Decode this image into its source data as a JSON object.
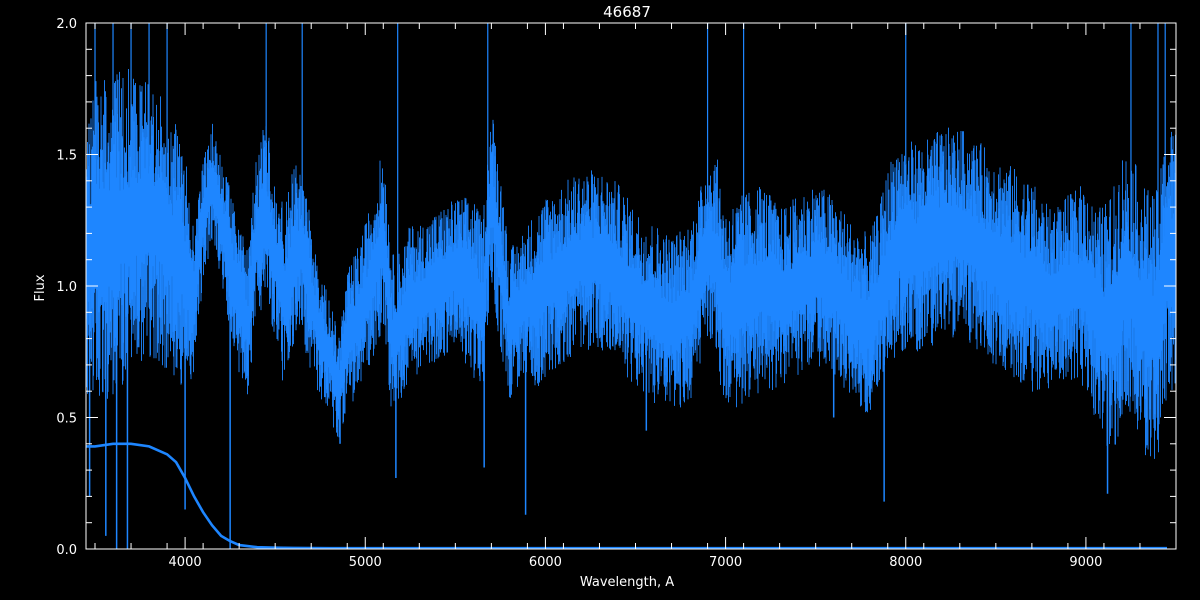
{
  "chart_data": {
    "type": "line",
    "title": "46687",
    "xlabel": "Wavelength, A",
    "ylabel": "Flux",
    "xlim": [
      3450,
      9500
    ],
    "ylim": [
      0.0,
      2.0
    ],
    "grid": false,
    "background_color": "#000000",
    "axis_color": "#ffffff",
    "line_color": "#1e86ff",
    "x_ticks": [
      {
        "value": 4000,
        "label": "4000"
      },
      {
        "value": 5000,
        "label": "5000"
      },
      {
        "value": 6000,
        "label": "6000"
      },
      {
        "value": 7000,
        "label": "7000"
      },
      {
        "value": 8000,
        "label": "8000"
      },
      {
        "value": 9000,
        "label": "9000"
      }
    ],
    "y_ticks": [
      {
        "value": 0.0,
        "label": "0.0"
      },
      {
        "value": 0.5,
        "label": "0.5"
      },
      {
        "value": 1.0,
        "label": "1.0"
      },
      {
        "value": 1.5,
        "label": "1.5"
      },
      {
        "value": 2.0,
        "label": "2.0"
      }
    ],
    "series": [
      {
        "style": "noisy-spectrum",
        "x": [
          3450,
          3500,
          3600,
          3700,
          3800,
          3900,
          4000,
          4050,
          4100,
          4150,
          4200,
          4250,
          4300,
          4350,
          4400,
          4450,
          4500,
          4550,
          4600,
          4650,
          4700,
          4750,
          4800,
          4850,
          4900,
          4950,
          5000,
          5050,
          5100,
          5150,
          5200,
          5250,
          5300,
          5400,
          5500,
          5600,
          5650,
          5700,
          5750,
          5800,
          5850,
          5900,
          5950,
          6000,
          6100,
          6200,
          6300,
          6400,
          6500,
          6600,
          6700,
          6800,
          6850,
          6900,
          6950,
          7000,
          7100,
          7200,
          7300,
          7400,
          7500,
          7600,
          7700,
          7800,
          7850,
          7900,
          7950,
          8000,
          8100,
          8200,
          8300,
          8400,
          8500,
          8600,
          8700,
          8800,
          8900,
          9000,
          9050,
          9100,
          9150,
          9200,
          9250,
          9300,
          9350,
          9400,
          9450
        ],
        "center": [
          1.15,
          1.15,
          1.2,
          1.25,
          1.25,
          1.2,
          1.05,
          0.95,
          1.25,
          1.4,
          1.25,
          1.1,
          0.95,
          0.85,
          1.2,
          1.3,
          1.1,
          0.95,
          1.1,
          1.15,
          0.95,
          0.8,
          0.75,
          0.6,
          0.8,
          0.85,
          0.95,
          1.05,
          1.2,
          0.8,
          0.85,
          0.95,
          0.95,
          1.0,
          1.05,
          1.0,
          0.9,
          1.35,
          1.1,
          0.85,
          0.9,
          0.95,
          0.95,
          1.0,
          1.05,
          1.1,
          1.1,
          1.05,
          0.95,
          0.9,
          0.85,
          0.9,
          1.0,
          1.15,
          1.1,
          0.9,
          0.95,
          1.0,
          0.95,
          1.0,
          1.05,
          1.0,
          0.9,
          0.85,
          0.95,
          1.05,
          1.15,
          1.15,
          1.15,
          1.2,
          1.2,
          1.15,
          1.1,
          1.05,
          1.0,
          0.95,
          1.0,
          1.0,
          0.9,
          0.85,
          0.85,
          1.0,
          1.0,
          0.9,
          0.85,
          0.85,
          1.1
        ],
        "spread": [
          0.5,
          0.55,
          0.55,
          0.5,
          0.45,
          0.45,
          0.4,
          0.25,
          0.2,
          0.2,
          0.2,
          0.25,
          0.25,
          0.25,
          0.3,
          0.3,
          0.3,
          0.3,
          0.3,
          0.3,
          0.25,
          0.2,
          0.2,
          0.18,
          0.22,
          0.25,
          0.25,
          0.28,
          0.3,
          0.28,
          0.25,
          0.25,
          0.25,
          0.25,
          0.25,
          0.3,
          0.3,
          0.3,
          0.3,
          0.25,
          0.25,
          0.25,
          0.3,
          0.3,
          0.3,
          0.3,
          0.3,
          0.3,
          0.3,
          0.3,
          0.3,
          0.3,
          0.3,
          0.3,
          0.35,
          0.35,
          0.35,
          0.35,
          0.3,
          0.3,
          0.3,
          0.3,
          0.3,
          0.3,
          0.3,
          0.35,
          0.35,
          0.35,
          0.35,
          0.35,
          0.35,
          0.35,
          0.35,
          0.35,
          0.35,
          0.3,
          0.3,
          0.35,
          0.35,
          0.4,
          0.45,
          0.45,
          0.45,
          0.45,
          0.45,
          0.45,
          0.45
        ]
      },
      {
        "style": "smooth-curve",
        "x": [
          3450,
          3500,
          3600,
          3700,
          3800,
          3900,
          3950,
          4000,
          4050,
          4100,
          4150,
          4200,
          4250,
          4300,
          4400,
          4500,
          4600,
          4800,
          5000,
          6000,
          7000,
          8000,
          9000,
          9450
        ],
        "y": [
          0.39,
          0.39,
          0.4,
          0.4,
          0.39,
          0.36,
          0.33,
          0.27,
          0.2,
          0.14,
          0.09,
          0.05,
          0.03,
          0.015,
          0.007,
          0.005,
          0.004,
          0.003,
          0.003,
          0.003,
          0.003,
          0.003,
          0.003,
          0.003
        ]
      }
    ],
    "absorption_lines": [
      {
        "x": 3470,
        "y_low": 0.2
      },
      {
        "x": 3560,
        "y_low": 0.05
      },
      {
        "x": 3620,
        "y_low": 0.0
      },
      {
        "x": 3680,
        "y_low": 0.0
      },
      {
        "x": 4000,
        "y_low": 0.15
      },
      {
        "x": 4250,
        "y_low": 0.0
      },
      {
        "x": 4860,
        "y_low": 0.4
      },
      {
        "x": 5170,
        "y_low": 0.27
      },
      {
        "x": 5660,
        "y_low": 0.31
      },
      {
        "x": 5890,
        "y_low": 0.13
      },
      {
        "x": 6560,
        "y_low": 0.45
      },
      {
        "x": 7600,
        "y_low": 0.5
      },
      {
        "x": 7880,
        "y_low": 0.18
      },
      {
        "x": 9120,
        "y_low": 0.21
      }
    ],
    "spikes": [
      {
        "x": 3500,
        "y_high": 2.0
      },
      {
        "x": 3600,
        "y_high": 2.0
      },
      {
        "x": 3700,
        "y_high": 2.0
      },
      {
        "x": 3800,
        "y_high": 2.0
      },
      {
        "x": 3900,
        "y_high": 2.0
      },
      {
        "x": 4450,
        "y_high": 2.0
      },
      {
        "x": 4650,
        "y_high": 2.0
      },
      {
        "x": 5180,
        "y_high": 2.0
      },
      {
        "x": 5680,
        "y_high": 2.0
      },
      {
        "x": 6900,
        "y_high": 2.0
      },
      {
        "x": 7100,
        "y_high": 2.0
      },
      {
        "x": 8000,
        "y_high": 2.0
      },
      {
        "x": 9250,
        "y_high": 2.0
      },
      {
        "x": 9400,
        "y_high": 2.0
      },
      {
        "x": 9440,
        "y_high": 2.0
      }
    ]
  }
}
